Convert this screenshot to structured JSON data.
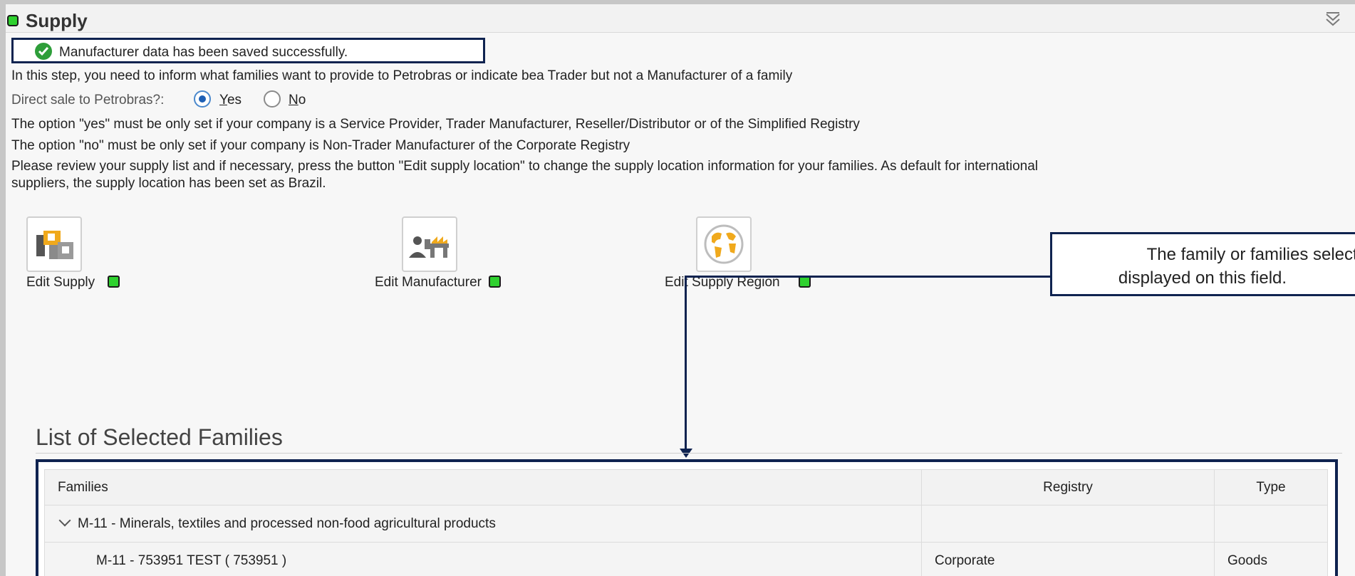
{
  "panel": {
    "title": "Supply",
    "status_color": "#2fd12f"
  },
  "success_message": "Manufacturer data has been saved successfully.",
  "intro_text": "In this step, you need to inform what families want to provide to Petrobras or indicate bea Trader but not a Manufacturer of a family",
  "direct_sale": {
    "label": "Direct sale to Petrobras?:",
    "selected": "Yes",
    "options": [
      {
        "label": "Yes",
        "mnemonic": "Y",
        "rest": "es",
        "checked": true
      },
      {
        "label": "No",
        "mnemonic": "N",
        "rest": "o",
        "checked": false
      }
    ]
  },
  "notes": [
    "The option \"yes\" must be only set if your company is a Service Provider, Trader Manufacturer, Reseller/Distributor or of the Simplified Registry",
    "The option \"no\" must be only set if your company is Non-Trader Manufacturer of the Corporate Registry",
    "Please review your supply list and if necessary, press the button \"Edit supply location\" to change the supply location information for your families. As default for international",
    "suppliers, the supply location has been set as Brazil."
  ],
  "actions": [
    {
      "label": "Edit Supply",
      "icon": "supply-icon",
      "status": "complete"
    },
    {
      "label": "Edit Manufacturer",
      "icon": "manufacturer-icon",
      "status": "complete"
    },
    {
      "label": "Edit Supply Region",
      "icon": "globe-icon",
      "status": "complete"
    }
  ],
  "callout": {
    "line1": "The family or families selected w",
    "line2": "displayed on this field."
  },
  "families_section": {
    "title": "List of Selected Families",
    "columns": [
      "Families",
      "Registry",
      "Type"
    ],
    "group": {
      "label": "M-11 - Minerals, textiles and processed non-food agricultural products",
      "registry": "",
      "type": ""
    },
    "rows": [
      {
        "family": "M-11 - 753951  TEST ( 753951 )",
        "registry": "Corporate",
        "type": "Goods"
      }
    ]
  },
  "colors": {
    "accent_navy": "#0f2350",
    "status_green": "#2fd12f",
    "success_green": "#2e9e3a",
    "radio_blue": "#1d5fb5",
    "icon_orange": "#f0a91c"
  }
}
